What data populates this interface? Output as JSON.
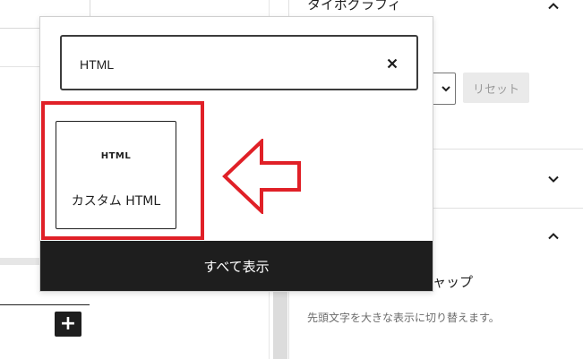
{
  "inserter": {
    "search_value": "HTML",
    "clear_icon": "close-icon",
    "result": {
      "icon_text": "HTML",
      "label": "カスタム HTML"
    },
    "show_all_label": "すべて表示",
    "annotation_arrow_color": "#e02027",
    "highlight_color": "#e02027"
  },
  "sidebar": {
    "typography_title": "タイポグラフィ",
    "reset_label": "リセット",
    "drop_cap_label": "ャップ",
    "drop_cap_help": "先頭文字を大きな表示に切り替えます。"
  },
  "editor": {
    "add_block_glyph": "+"
  },
  "colors": {
    "dark": "#1e1e1e",
    "annotation": "#e02027",
    "muted_button": "#eaeaea"
  }
}
